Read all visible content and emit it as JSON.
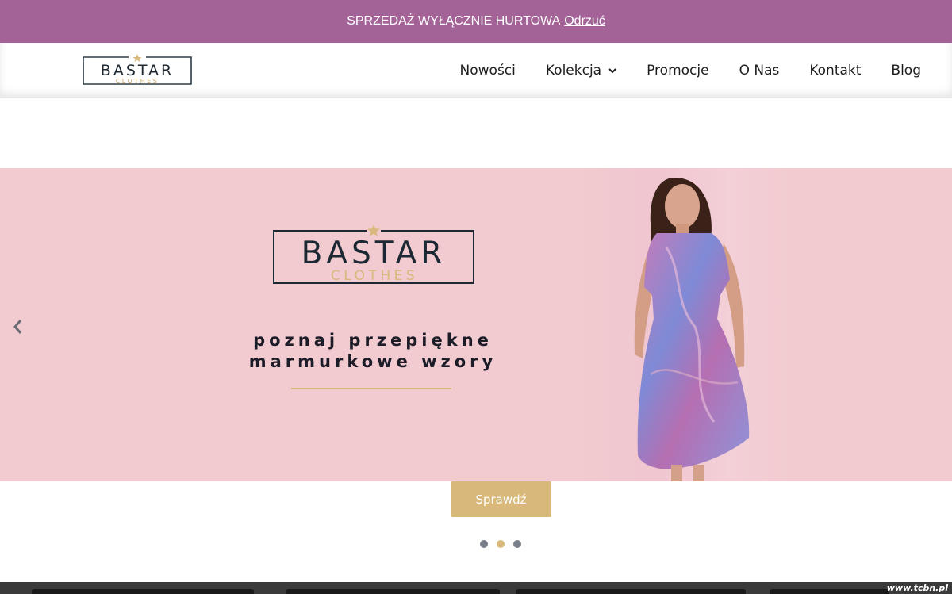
{
  "notice": {
    "text": "SPRZEDAŻ WYŁĄCZNIE HURTOWA",
    "dismiss": "Odrzuć"
  },
  "brand": {
    "name": "BASTAR",
    "sub": "CLOTHES"
  },
  "nav": {
    "items": [
      {
        "label": "Nowości"
      },
      {
        "label": "Kolekcja",
        "has_dropdown": true
      },
      {
        "label": "Promocje"
      },
      {
        "label": "O Nas"
      },
      {
        "label": "Kontakt"
      },
      {
        "label": "Blog"
      }
    ]
  },
  "hero": {
    "tagline_line1": "poznaj przepiękne",
    "tagline_line2": "marmurkowe wzory",
    "cta": "Sprawdź",
    "slides": 3,
    "active_slide": 2
  },
  "watermark": "www.tcbn.pl",
  "colors": {
    "notice_bg": "#a36397",
    "hero_bg": "#f1cbcf",
    "accent_gold": "#d8b87b",
    "text_dark": "#1d1d1d"
  }
}
